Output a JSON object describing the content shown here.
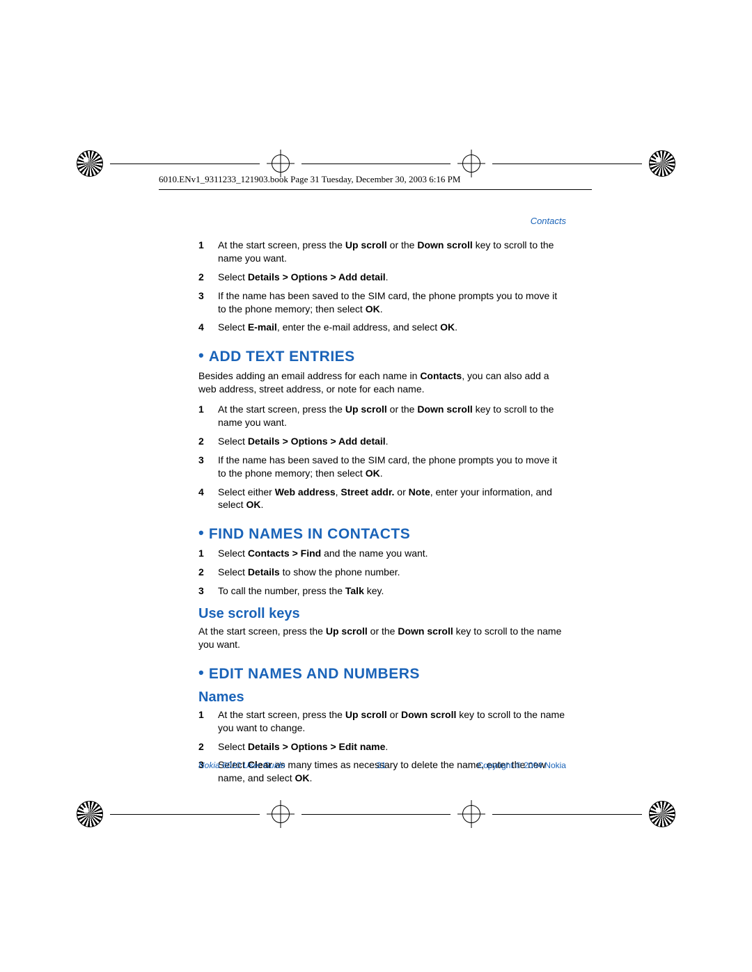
{
  "filepath": "6010.ENv1_9311233_121903.book  Page 31  Tuesday, December 30, 2003  6:16 PM",
  "chapter": "Contacts",
  "intro_steps": [
    {
      "n": "1",
      "segs": [
        {
          "t": "At the start screen, press the "
        },
        {
          "t": "Up scroll",
          "b": true
        },
        {
          "t": " or the "
        },
        {
          "t": "Down scroll",
          "b": true
        },
        {
          "t": " key to scroll to the name you want."
        }
      ]
    },
    {
      "n": "2",
      "segs": [
        {
          "t": "Select "
        },
        {
          "t": "Details > Options > Add detail",
          "b": true
        },
        {
          "t": "."
        }
      ]
    },
    {
      "n": "3",
      "segs": [
        {
          "t": "If the name has been saved to the SIM card, the phone prompts you to move it to the phone memory; then select "
        },
        {
          "t": "OK",
          "b": true
        },
        {
          "t": "."
        }
      ]
    },
    {
      "n": "4",
      "segs": [
        {
          "t": "Select "
        },
        {
          "t": "E-mail",
          "b": true
        },
        {
          "t": ", enter the e-mail address, and select "
        },
        {
          "t": "OK",
          "b": true
        },
        {
          "t": "."
        }
      ]
    }
  ],
  "sec1": {
    "title": "ADD TEXT ENTRIES",
    "para_segs": [
      {
        "t": "Besides adding an email address for each name in "
      },
      {
        "t": "Contacts",
        "b": true
      },
      {
        "t": ", you can also add a web address, street address, or note for each name."
      }
    ],
    "steps": [
      {
        "n": "1",
        "segs": [
          {
            "t": "At the start screen, press the "
          },
          {
            "t": "Up scroll",
            "b": true
          },
          {
            "t": " or the "
          },
          {
            "t": "Down scroll",
            "b": true
          },
          {
            "t": " key to scroll to the name you want."
          }
        ]
      },
      {
        "n": "2",
        "segs": [
          {
            "t": "Select "
          },
          {
            "t": "Details > Options > Add detail",
            "b": true
          },
          {
            "t": "."
          }
        ]
      },
      {
        "n": "3",
        "segs": [
          {
            "t": "If the name has been saved to the SIM card, the phone prompts you to move it to the phone memory; then select "
          },
          {
            "t": "OK",
            "b": true
          },
          {
            "t": "."
          }
        ]
      },
      {
        "n": "4",
        "segs": [
          {
            "t": "Select either "
          },
          {
            "t": "Web address",
            "b": true
          },
          {
            "t": ", "
          },
          {
            "t": "Street addr.",
            "b": true
          },
          {
            "t": " or "
          },
          {
            "t": "Note",
            "b": true
          },
          {
            "t": ", enter your information, and select "
          },
          {
            "t": "OK",
            "b": true
          },
          {
            "t": "."
          }
        ]
      }
    ]
  },
  "sec2": {
    "title": "FIND NAMES IN CONTACTS",
    "steps": [
      {
        "n": "1",
        "segs": [
          {
            "t": "Select "
          },
          {
            "t": "Contacts > Find",
            "b": true
          },
          {
            "t": " and the name you want."
          }
        ]
      },
      {
        "n": "2",
        "segs": [
          {
            "t": "Select "
          },
          {
            "t": "Details",
            "b": true
          },
          {
            "t": " to show the phone number."
          }
        ]
      },
      {
        "n": "3",
        "segs": [
          {
            "t": "To call the number, press the "
          },
          {
            "t": "Talk",
            "b": true
          },
          {
            "t": " key."
          }
        ]
      }
    ],
    "sub_title": "Use scroll keys",
    "sub_para_segs": [
      {
        "t": "At the start screen, press the "
      },
      {
        "t": "Up scroll",
        "b": true
      },
      {
        "t": " or the "
      },
      {
        "t": "Down scroll",
        "b": true
      },
      {
        "t": " key to scroll to the name you want."
      }
    ]
  },
  "sec3": {
    "title": "EDIT NAMES AND NUMBERS",
    "sub_title": "Names",
    "steps": [
      {
        "n": "1",
        "segs": [
          {
            "t": "At the start screen, press the "
          },
          {
            "t": "Up scroll",
            "b": true
          },
          {
            "t": " or "
          },
          {
            "t": "Down scroll",
            "b": true
          },
          {
            "t": " key to scroll to the name you want to change."
          }
        ]
      },
      {
        "n": "2",
        "segs": [
          {
            "t": "Select "
          },
          {
            "t": "Details > Options > Edit name",
            "b": true
          },
          {
            "t": "."
          }
        ]
      },
      {
        "n": "3",
        "segs": [
          {
            "t": "Select "
          },
          {
            "t": "Clear",
            "b": true
          },
          {
            "t": " as many times as necessary to delete the name, enter the new name, and select "
          },
          {
            "t": "OK",
            "b": true
          },
          {
            "t": "."
          }
        ]
      }
    ]
  },
  "footer": {
    "guide": "Nokia 6010 User Guide",
    "pagenum": "31",
    "copyright": "Copyright © 2004 Nokia"
  }
}
